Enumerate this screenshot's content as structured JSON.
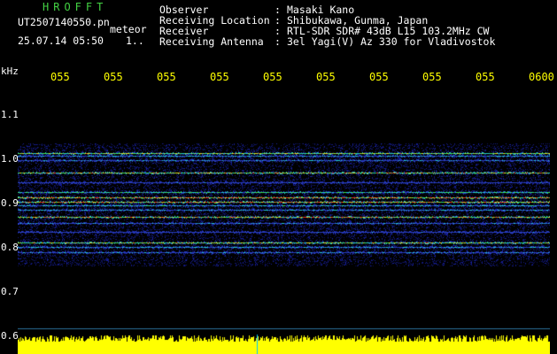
{
  "header": {
    "app_title": "HROFFT",
    "file_name": "UT2507140550.pn",
    "mode": "meteor",
    "date_time": "25.07.14 05:50",
    "count": "1.."
  },
  "info": [
    {
      "key": "Observer",
      "sep": ":",
      "value": "Masaki Kano"
    },
    {
      "key": "Receiving Location",
      "sep": ":",
      "value": "Shibukawa, Gunma, Japan"
    },
    {
      "key": "Receiver",
      "sep": ":",
      "value": "RTL-SDR SDR# 43dB L15 103.2MHz CW"
    },
    {
      "key": "Receiving Antenna",
      "sep": ":",
      "value": "3el Yagi(V) Az 330 for Vladivostok"
    }
  ],
  "axis": {
    "unit": "kHz",
    "time_ticks": [
      "055",
      "055",
      "055",
      "055",
      "055",
      "055",
      "055",
      "055",
      "055",
      "0600"
    ],
    "freq_ticks": [
      "1.1",
      "1.0",
      "0.9",
      "0.8",
      "0.7",
      "0.6"
    ]
  },
  "colors": {
    "title": "#43d243",
    "time_ticks": "#ffff00",
    "noise_floor": "#ffff00",
    "background": "#000000",
    "signal_low": "#1a2a9a",
    "signal_mid": "#22c8d0",
    "signal_high": "#e83020"
  }
}
